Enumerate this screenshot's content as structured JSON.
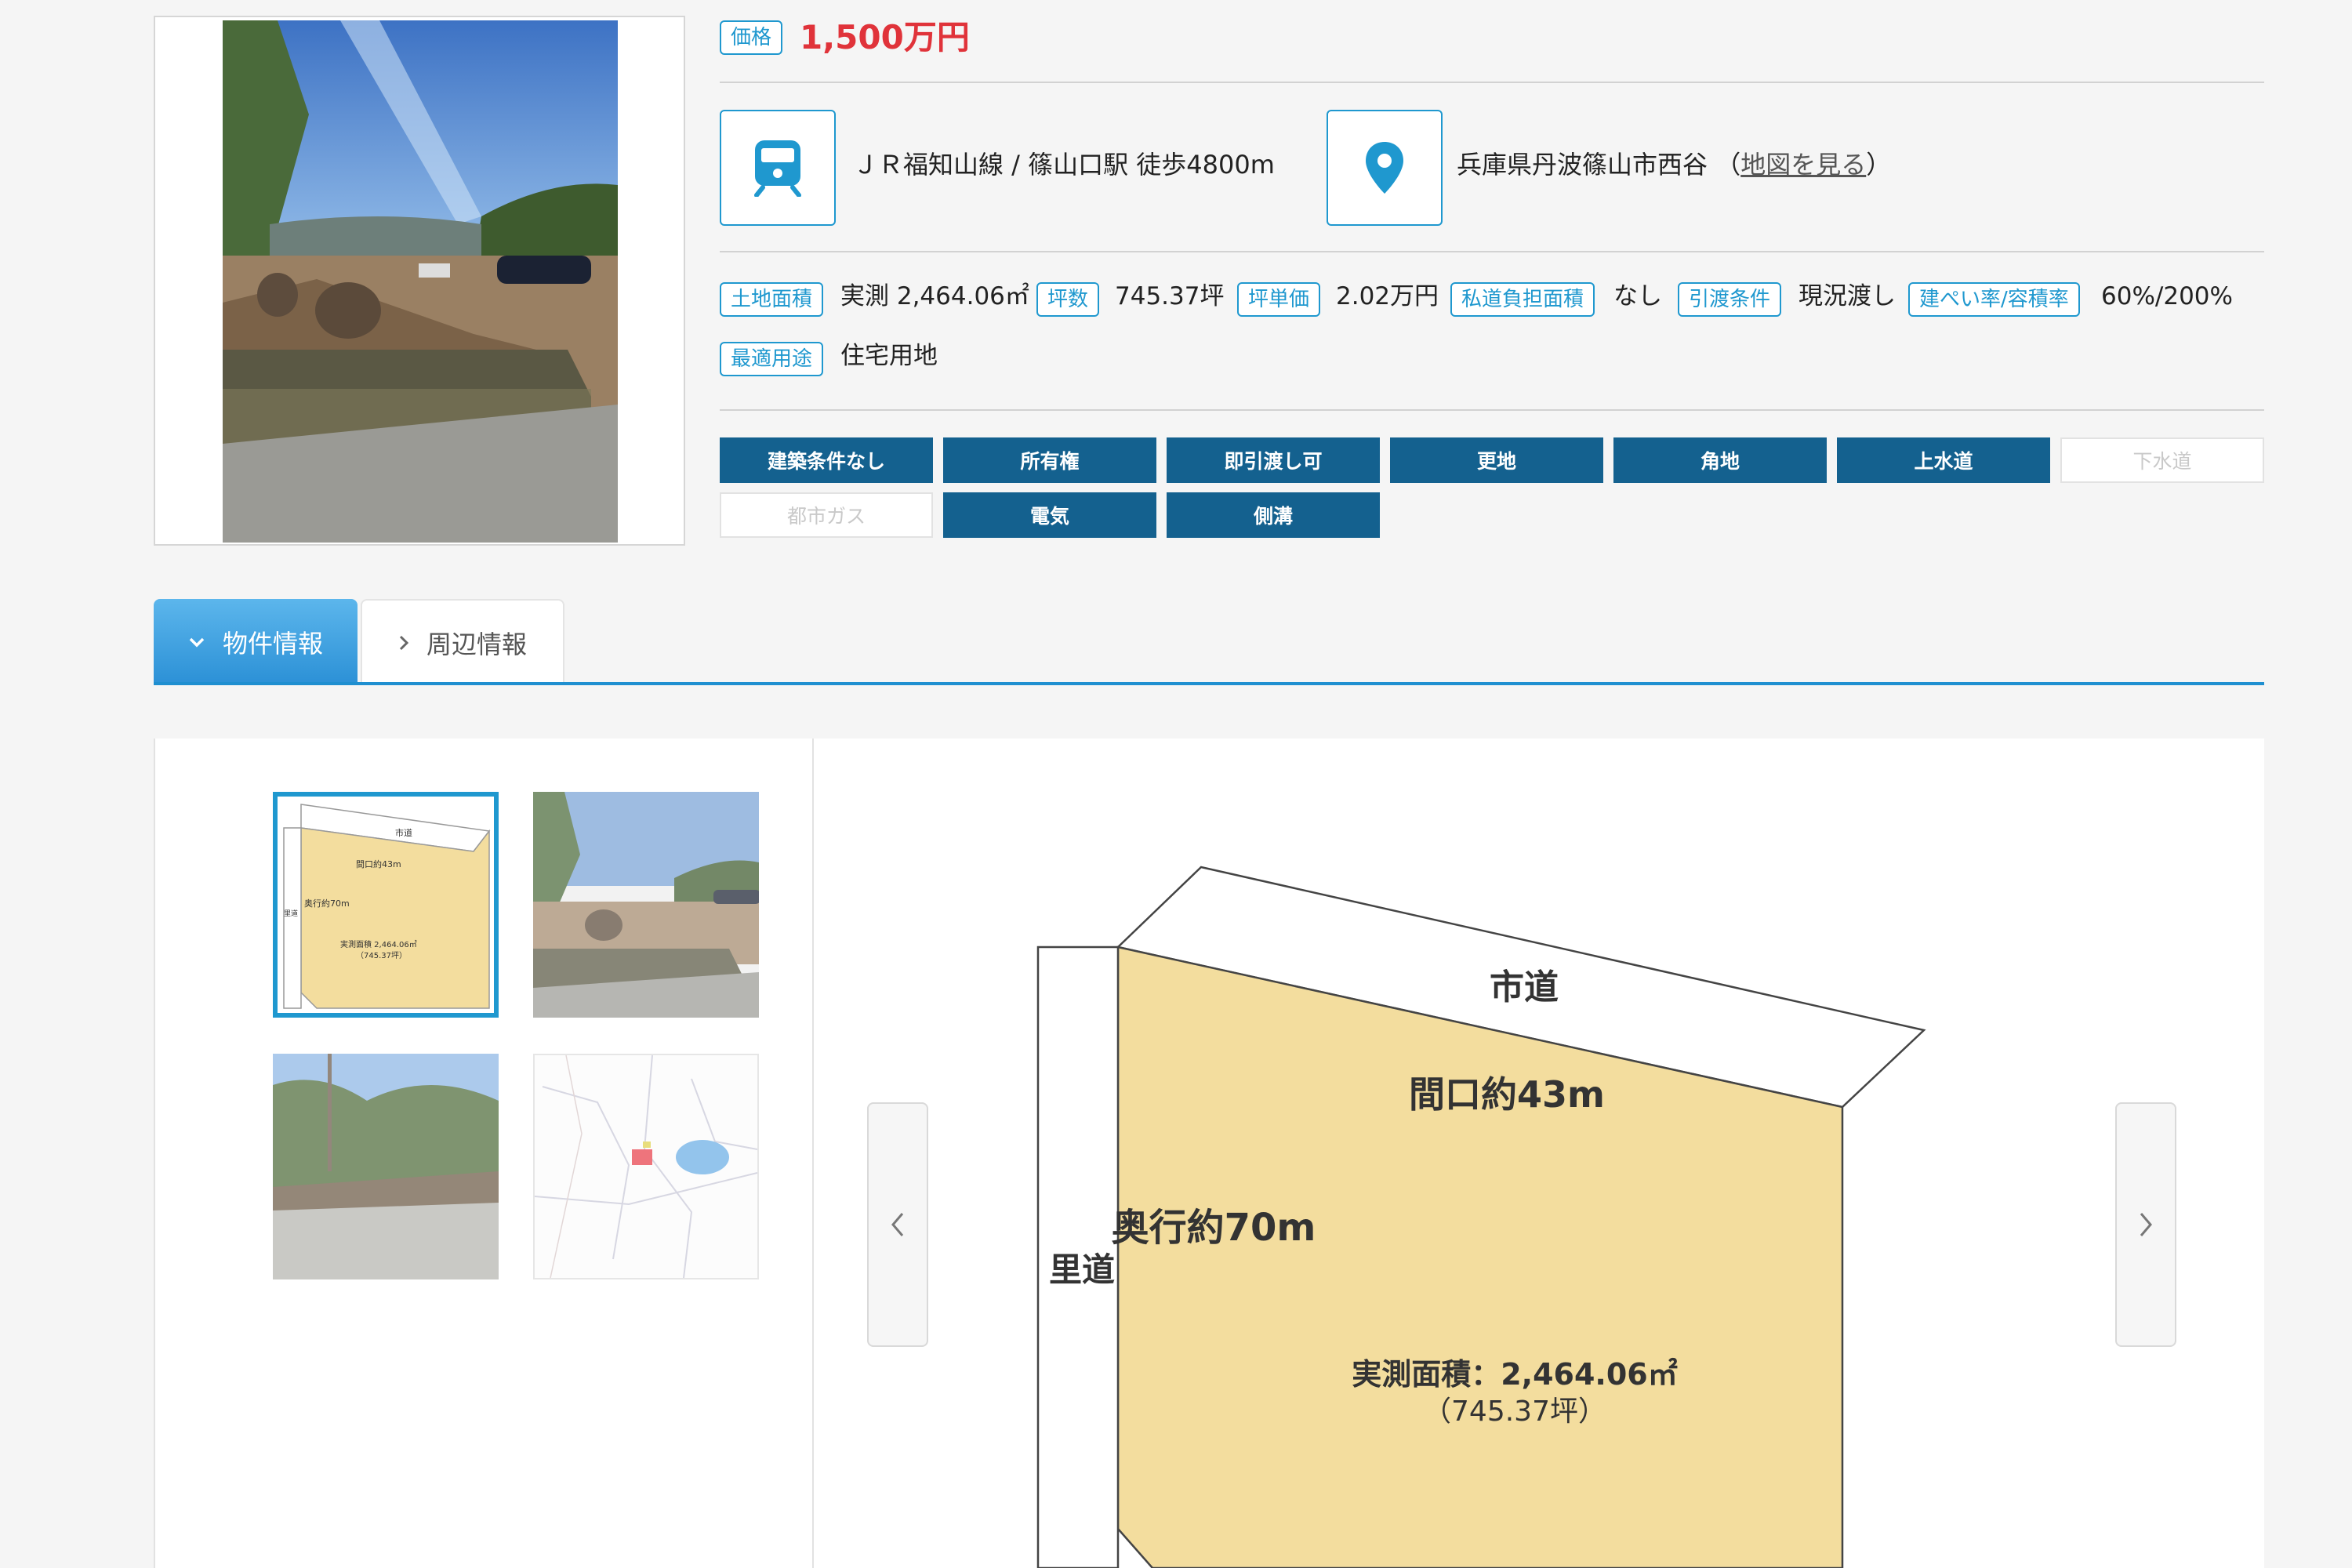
{
  "price": {
    "label": "価格",
    "value": "1,500万円"
  },
  "access": {
    "station": "ＪＲ福知山線 / 篠山口駅 徒歩4800m",
    "address": "兵庫県丹波篠山市西谷",
    "map_link_open": "（",
    "map_link": "地図を見る",
    "map_link_close": "）"
  },
  "specs": [
    {
      "label": "土地面積",
      "value": "実測 2,464.06㎡"
    },
    {
      "label": "坪数",
      "value": "745.37坪"
    },
    {
      "label": "坪単価",
      "value": "2.02万円"
    },
    {
      "label": "私道負担面積",
      "value": "なし"
    },
    {
      "label": "引渡条件",
      "value": "現況渡し"
    },
    {
      "label": "建ぺい率/容積率",
      "value": "60%/200%"
    },
    {
      "label": "最適用途",
      "value": "住宅用地"
    }
  ],
  "features": [
    {
      "label": "建築条件なし",
      "active": true
    },
    {
      "label": "所有権",
      "active": true
    },
    {
      "label": "即引渡し可",
      "active": true
    },
    {
      "label": "更地",
      "active": true
    },
    {
      "label": "角地",
      "active": true
    },
    {
      "label": "上水道",
      "active": true
    },
    {
      "label": "下水道",
      "active": false
    },
    {
      "label": "都市ガス",
      "active": false
    },
    {
      "label": "電気",
      "active": true
    },
    {
      "label": "側溝",
      "active": true
    }
  ],
  "tabs": {
    "property": "物件情報",
    "surroundings": "周辺情報"
  },
  "plot": {
    "road_city": "市道",
    "frontage": "間口約43m",
    "depth": "奥行約70m",
    "road_village": "里道",
    "area_label": "実測面積：2,464.06㎡",
    "area_tsubo": "（745.37坪）"
  },
  "thumb_plot": {
    "road_city": "市道",
    "frontage": "間口約43m",
    "depth": "奥行約70m",
    "road_village": "里道",
    "area_label": "実測面積 2,464.06㎡",
    "area_tsubo": "（745.37坪）"
  },
  "colors": {
    "accent": "#1f98cf",
    "price": "#e0333a",
    "feature_active": "#14618f",
    "plot_fill": "#f3dd9e"
  },
  "icons": {
    "station": "train-icon",
    "address": "map-pin-icon",
    "prev": "chevron-left-icon",
    "next": "chevron-right-icon",
    "tab_open": "chevron-down-icon",
    "tab_closed": "chevron-right-icon"
  }
}
